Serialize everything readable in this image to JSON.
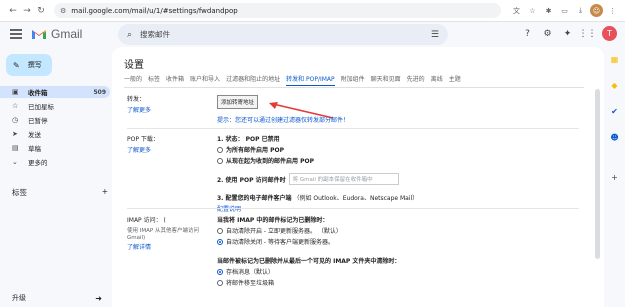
{
  "browser": {
    "back": "←",
    "forward": "→",
    "reload": "↻",
    "url": "mail.google.com/mail/u/1/#settings/fwdandpop",
    "ext_icons": [
      "translate-icon",
      "star-icon",
      "puzzle-icon",
      "window-icon",
      "download-icon"
    ],
    "profile_initial": "☺",
    "menu": "⋮"
  },
  "header": {
    "app_name": "Gmail",
    "search_placeholder": "搜索邮件",
    "avatar": "T"
  },
  "sidebar": {
    "compose": "撰写",
    "items": [
      {
        "icon": "▣",
        "label": "收件箱",
        "count": "509",
        "active": true
      },
      {
        "icon": "☆",
        "label": "已加星标",
        "count": ""
      },
      {
        "icon": "◷",
        "label": "已暂停",
        "count": ""
      },
      {
        "icon": "➤",
        "label": "发送",
        "count": ""
      },
      {
        "icon": "▤",
        "label": "草稿",
        "count": ""
      },
      {
        "icon": "⌄",
        "label": "更多的",
        "count": ""
      }
    ],
    "labels_title": "标签",
    "labels_add": "+",
    "upgrade": "升级"
  },
  "settings": {
    "title": "设置",
    "tabs": [
      "一般的",
      "标签",
      "收件箱",
      "账户和导入",
      "过滤器和阻止的地址",
      "转发和 POP/IMAP",
      "附加组件",
      "聊天和见面",
      "先进的",
      "离线",
      "主题"
    ],
    "active_tab": "转发和 POP/IMAP",
    "forwarding": {
      "label": "转发：",
      "learn_more": "了解更多",
      "button": "添加转寄地址",
      "tip": "提示：您还可以通过创建过滤器仅转发部分邮件！"
    },
    "pop": {
      "label": "POP 下载：",
      "learn_more": "了解更多",
      "status": "1. 状态： POP 已禁用",
      "opt1": "为所有邮件启用 POP",
      "opt2": "从现在起为收到的邮件启用 POP",
      "step2": "2. 使用 POP 访问邮件时",
      "step2_select": "将 Gmail 的副本保留在收件箱中",
      "step3": "3. 配置您的电子邮件客户端",
      "step3_hint": "（例如 Outlook、Eudora、Netscape Mail）",
      "config_link": "配置说明"
    },
    "imap": {
      "label": "IMAP 访问：",
      "paren": "(",
      "desc": "使用 IMAP 从其他客户端访问",
      "desc2": "Gmail)",
      "learn_more": "了解详情",
      "q1": "当我将 IMAP 中的邮件标记为已删除时：",
      "q1_opt1": "自动清除开启 - 立即更新服务器。 （默认）",
      "q1_opt2": "自动清除关闭 - 等待客户端更新服务器。",
      "q2": "当邮件被标记为已删除并从最后一个可见的 IMAP 文件夹中清除时：",
      "q2_opt1": "存档消息（默认）",
      "q2_opt2": "将邮件移至垃圾箱"
    }
  },
  "colors": {
    "accent": "#0b57d0",
    "arrow": "#e53935",
    "compose_bg": "#c2e7ff"
  }
}
